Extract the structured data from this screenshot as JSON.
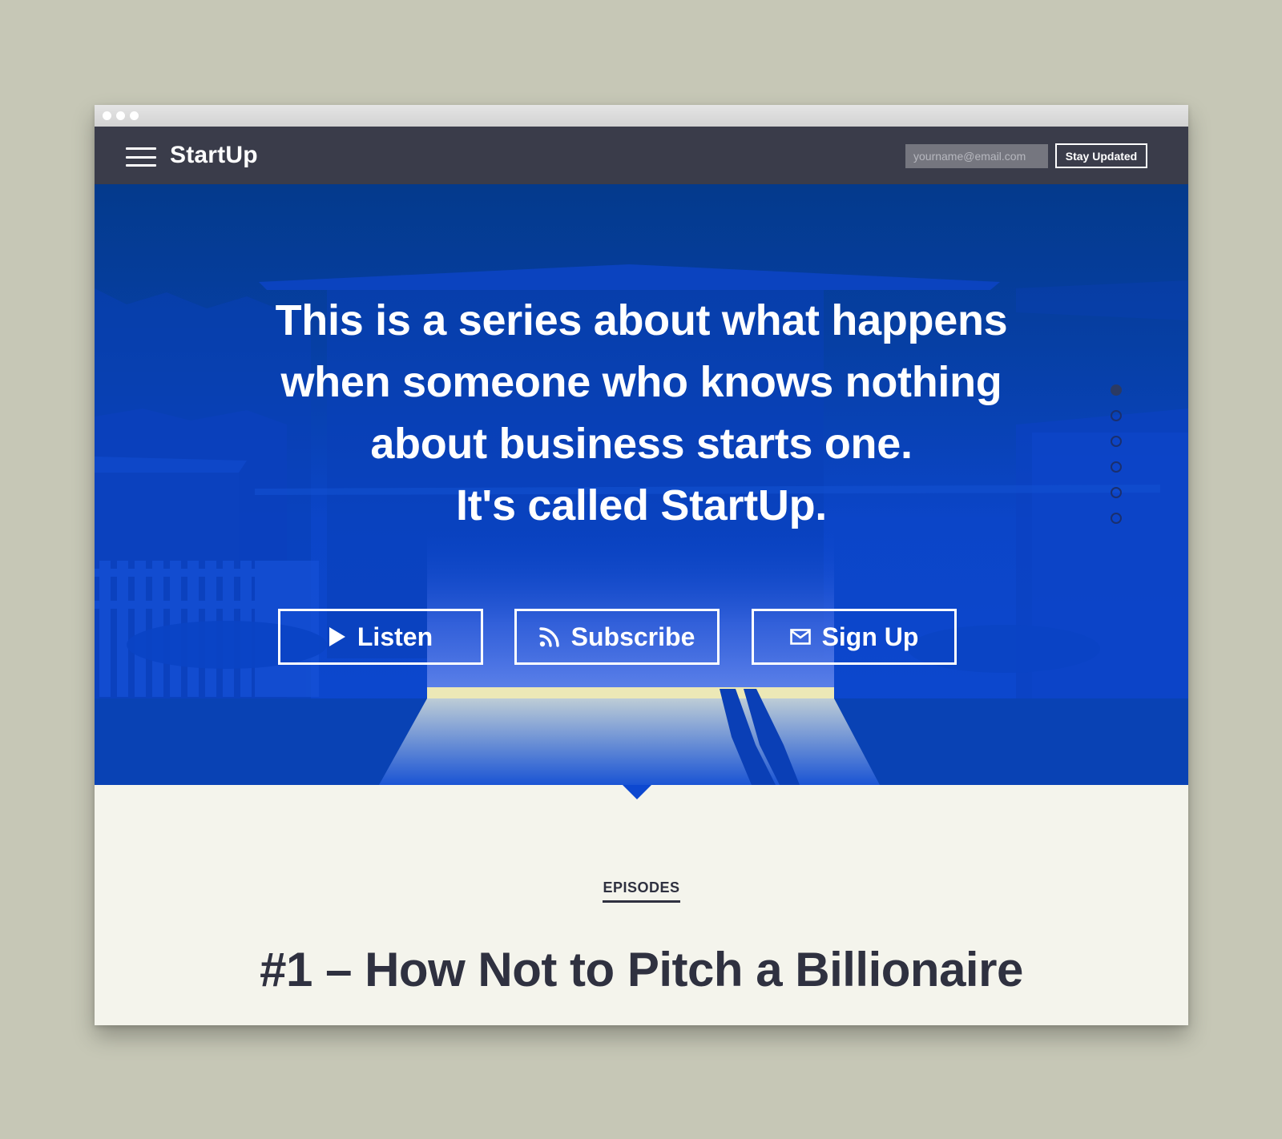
{
  "window": {
    "controls": [
      "close",
      "minimize",
      "maximize"
    ]
  },
  "header": {
    "brand": "StartUp",
    "menu_icon": "hamburger-menu-icon",
    "email_placeholder": "yourname@email.com",
    "email_value": "",
    "subscribe_label": "Stay Updated"
  },
  "hero": {
    "lines": [
      "This is a series about what happens",
      "when someone who knows nothing",
      "about business starts one.",
      "It's called StartUp."
    ],
    "buttons": [
      {
        "label": "Listen",
        "icon": "play-icon"
      },
      {
        "label": "Subscribe",
        "icon": "rss-icon"
      },
      {
        "label": "Sign Up",
        "icon": "envelope-icon"
      }
    ],
    "slide_count": 6,
    "active_slide": 1
  },
  "episodes": {
    "section_label": "EPISODES",
    "title": "#1 – How Not to Pitch a Billionaire"
  },
  "colors": {
    "page_background": "#c6c7b6",
    "navbar": "#3a3c4a",
    "hero_blue": "#0d48d0",
    "content_background": "#f4f4ec",
    "text_dark": "#2f3140"
  }
}
